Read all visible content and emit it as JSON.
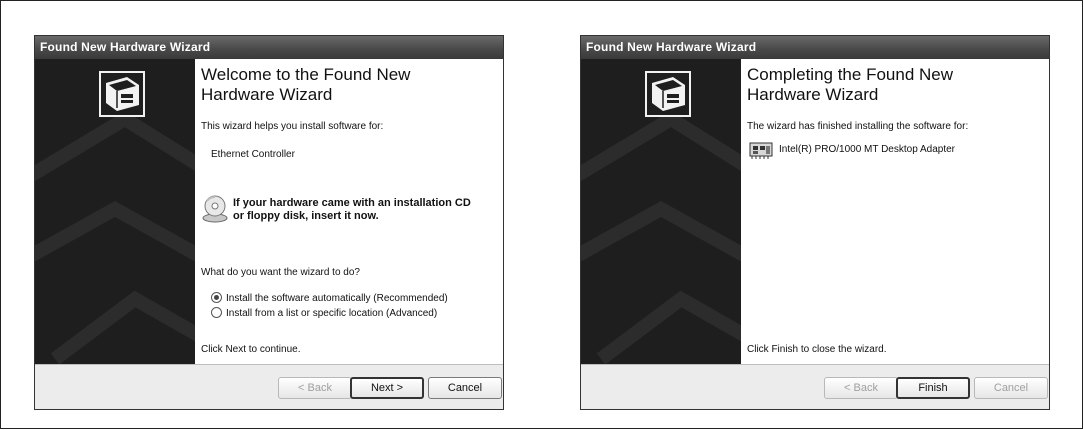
{
  "left_wizard": {
    "title": "Found New Hardware Wizard",
    "heading": "Welcome to the Found New Hardware Wizard",
    "intro": "This wizard helps you install software for:",
    "device": "Ethernet Controller",
    "cd_prompt_line1": "If your hardware came with an installation CD",
    "cd_prompt_line2": "or floppy disk, insert it now.",
    "question": "What do you want the wizard to do?",
    "options": [
      {
        "label": "Install the software automatically (Recommended)",
        "selected": true
      },
      {
        "label": "Install from a list or specific location (Advanced)",
        "selected": false
      }
    ],
    "footer": "Click Next to continue.",
    "buttons": {
      "back": "< Back",
      "next": "Next >",
      "cancel": "Cancel"
    }
  },
  "right_wizard": {
    "title": "Found New Hardware Wizard",
    "heading": "Completing the Found New Hardware Wizard",
    "intro": "The wizard has finished installing the software for:",
    "device": "Intel(R) PRO/1000 MT Desktop Adapter",
    "footer": "Click Finish to close the wizard.",
    "buttons": {
      "back": "< Back",
      "finish": "Finish",
      "cancel": "Cancel"
    }
  },
  "icons": {
    "hardware": "hardware-wizard-icon",
    "cd": "cd-drive-icon",
    "network": "network-adapter-icon"
  }
}
